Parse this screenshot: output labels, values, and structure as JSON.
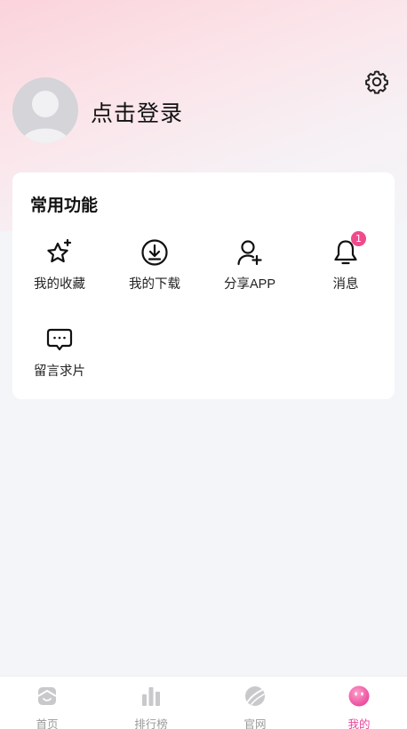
{
  "header": {
    "login_label": "点击登录"
  },
  "functions": {
    "title": "常用功能",
    "items": [
      {
        "label": "我的收藏",
        "icon": "star-sparkle-icon"
      },
      {
        "label": "我的下载",
        "icon": "download-icon"
      },
      {
        "label": "分享APP",
        "icon": "add-user-icon"
      },
      {
        "label": "消息",
        "icon": "bell-icon",
        "badge": "1"
      },
      {
        "label": "留言求片",
        "icon": "chat-bubble-icon"
      }
    ]
  },
  "tabbar": {
    "items": [
      {
        "label": "首页",
        "icon": "home-icon",
        "active": false
      },
      {
        "label": "排行榜",
        "icon": "bar-chart-icon",
        "active": false
      },
      {
        "label": "官网",
        "icon": "planet-icon",
        "active": false
      },
      {
        "label": "我的",
        "icon": "profile-face-icon",
        "active": true
      }
    ]
  },
  "colors": {
    "accent": "#e8459a",
    "badge": "#f0498c",
    "header_gradient_top": "#fbd3dc",
    "background": "#f4f5f8"
  }
}
